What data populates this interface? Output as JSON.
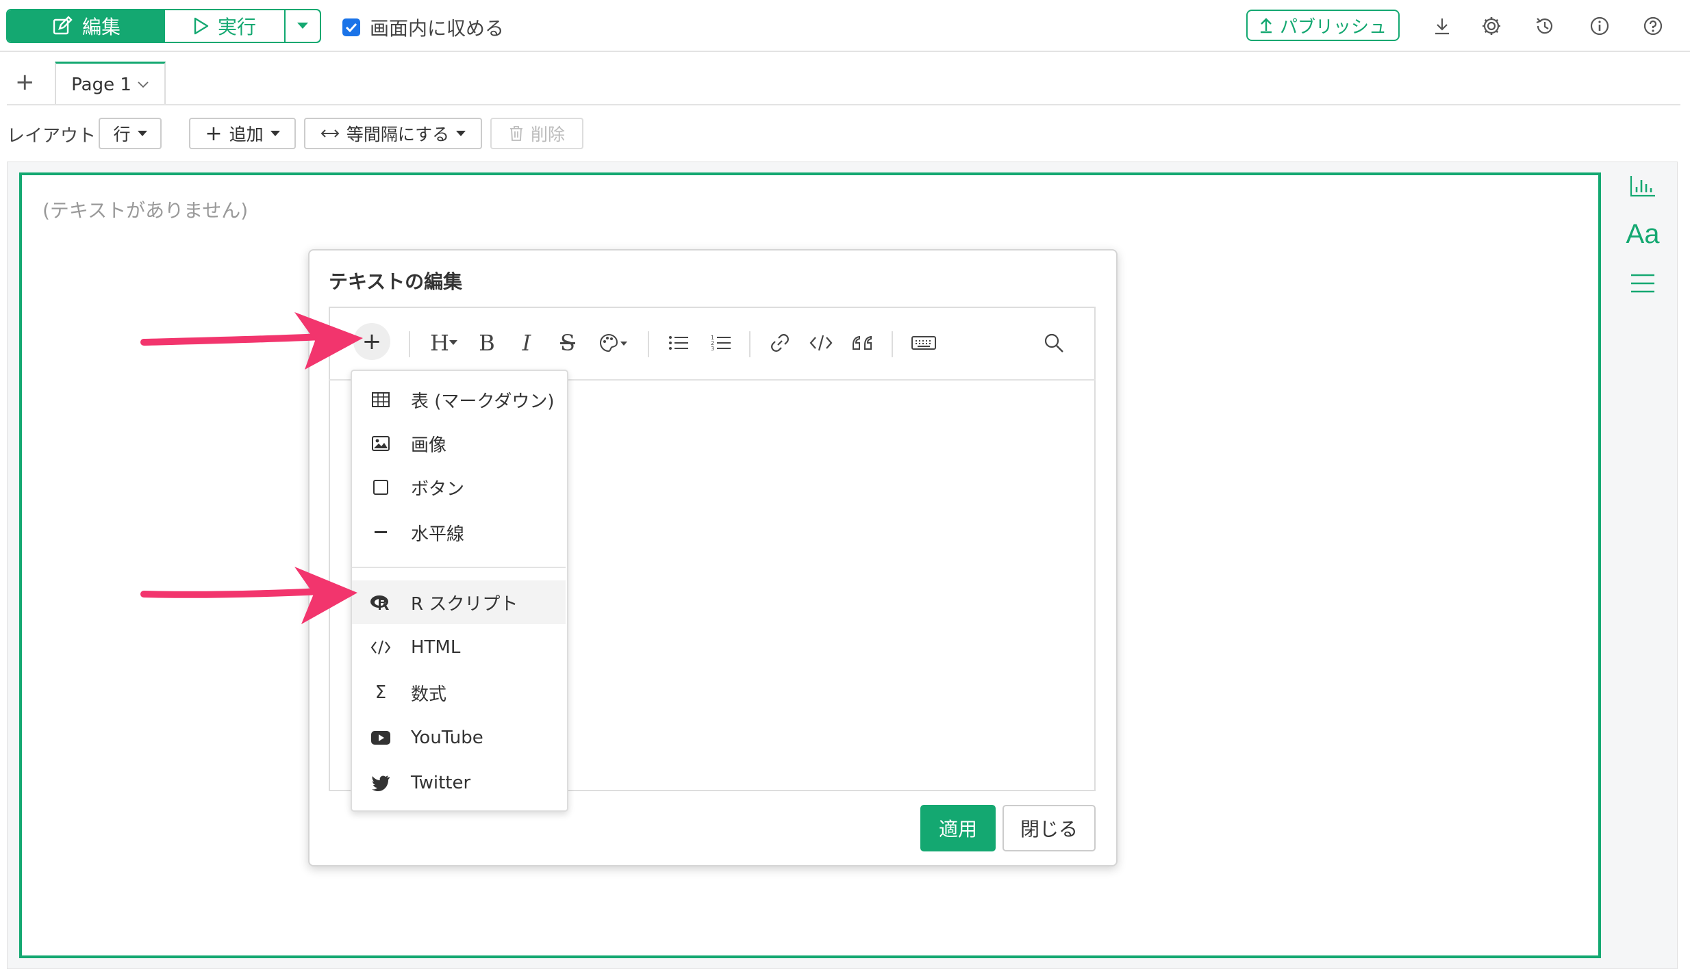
{
  "toolbar": {
    "edit_label": "編集",
    "run_label": "実行",
    "fit_label": "画面内に収める",
    "fit_checked": true,
    "publish_label": "パブリッシュ",
    "icons": [
      "download-icon",
      "gear-icon",
      "history-icon",
      "info-icon",
      "help-icon"
    ]
  },
  "tabs": {
    "add_label": "+",
    "pages": [
      {
        "label": "Page 1"
      }
    ]
  },
  "layout_bar": {
    "layout_label": "レイアウト",
    "layout_value": "行",
    "add_label": "追加",
    "equal_spacing_label": "等間隔にする",
    "delete_label": "削除"
  },
  "canvas": {
    "placeholder": "(テキストがありません)",
    "side_icons": [
      "bar-chart-icon",
      "text-style-icon",
      "menu-icon"
    ],
    "side_text_icon": "Aa"
  },
  "dialog": {
    "title": "テキストの編集",
    "toolbar_icons": [
      "plus-icon",
      "heading-icon",
      "bold-icon",
      "italic-icon",
      "strikethrough-icon",
      "palette-icon",
      "bullet-list-icon",
      "numbered-list-icon",
      "link-icon",
      "code-icon",
      "quote-icon",
      "keyboard-icon",
      "search-icon"
    ],
    "insert_menu": {
      "items": [
        {
          "label": "表 (マークダウン)",
          "icon": "table-icon"
        },
        {
          "label": "画像",
          "icon": "image-icon"
        },
        {
          "label": "ボタン",
          "icon": "button-icon"
        },
        {
          "label": "水平線",
          "icon": "horizontal-rule-icon"
        },
        {
          "label": "R スクリプト",
          "icon": "r-logo-icon",
          "highlighted": true
        },
        {
          "label": "HTML",
          "icon": "code-icon"
        },
        {
          "label": "数式",
          "icon": "sigma-icon"
        },
        {
          "label": "YouTube",
          "icon": "youtube-icon"
        },
        {
          "label": "Twitter",
          "icon": "twitter-icon"
        }
      ]
    },
    "apply_label": "適用",
    "close_label": "閉じる"
  },
  "colors": {
    "accent": "#14a871",
    "arrow": "#f2356d",
    "checkbox": "#1a73e8"
  }
}
